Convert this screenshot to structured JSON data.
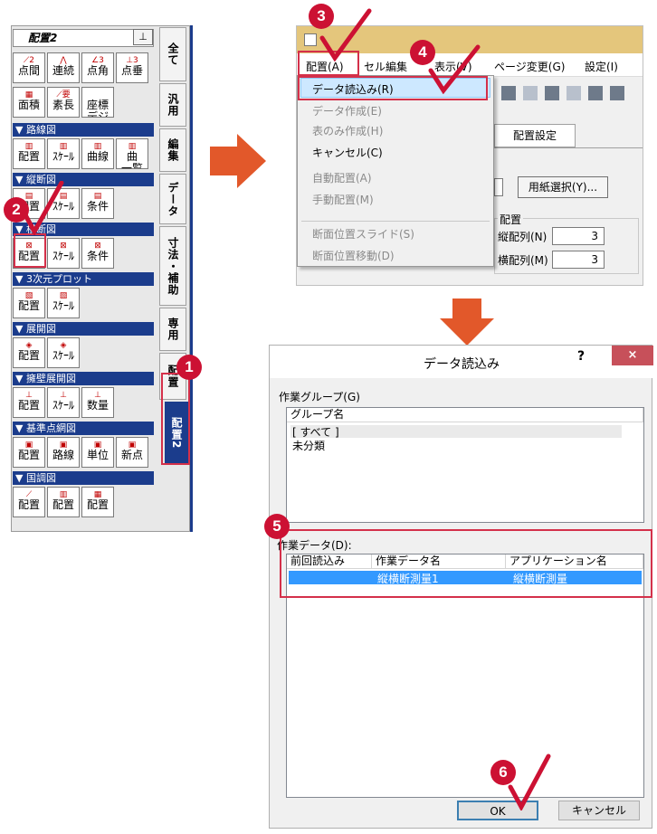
{
  "palette": {
    "title": "配置2",
    "pin": "⊥",
    "rows": [
      [
        {
          "l1": "点間",
          "icon": "⟋2"
        },
        {
          "l1": "連続",
          "icon": "⋀"
        },
        {
          "l1": "点角",
          "icon": "∠3"
        },
        {
          "l1": "点垂",
          "icon": "⊥3"
        }
      ],
      [
        {
          "l1": "面積",
          "icon": "▦"
        },
        {
          "l1": "素長",
          "icon": "⟋要"
        },
        {
          "l1": "座標\nデジ",
          "icon": ""
        }
      ]
    ],
    "sections": [
      {
        "title": "▼ 路線図",
        "buttons": [
          {
            "label": "配置",
            "icon": "▥"
          },
          {
            "label": "ｽｹｰﾙ",
            "icon": "▥"
          },
          {
            "label": "曲線",
            "icon": "▥"
          },
          {
            "label": "曲\n一覧",
            "icon": "▥"
          }
        ]
      },
      {
        "title": "▼ 縦断図",
        "buttons": [
          {
            "label": "配置",
            "icon": "▤"
          },
          {
            "label": "ｽｹｰﾙ",
            "icon": "▤"
          },
          {
            "label": "条件",
            "icon": "▤"
          }
        ]
      },
      {
        "title": "▼ 横断図",
        "buttons": [
          {
            "label": "配置",
            "icon": "⊠"
          },
          {
            "label": "ｽｹｰﾙ",
            "icon": "⊠"
          },
          {
            "label": "条件",
            "icon": "⊠"
          }
        ]
      },
      {
        "title": "▼ 3次元プロット",
        "buttons": [
          {
            "label": "配置",
            "icon": "▧"
          },
          {
            "label": "ｽｹｰﾙ",
            "icon": "▧"
          }
        ]
      },
      {
        "title": "▼ 展開図",
        "buttons": [
          {
            "label": "配置",
            "icon": "◈"
          },
          {
            "label": "ｽｹｰﾙ",
            "icon": "◈"
          }
        ]
      },
      {
        "title": "▼ 擁壁展開図",
        "buttons": [
          {
            "label": "配置",
            "icon": "⊥"
          },
          {
            "label": "ｽｹｰﾙ",
            "icon": "⊥"
          },
          {
            "label": "数量",
            "icon": "⊥"
          }
        ]
      },
      {
        "title": "▼ 基準点網図",
        "buttons": [
          {
            "label": "配置",
            "icon": "▣"
          },
          {
            "label": "路線",
            "icon": "▣"
          },
          {
            "label": "単位",
            "icon": "▣"
          },
          {
            "label": "新点",
            "icon": "▣"
          }
        ]
      },
      {
        "title": "▼ 国調図",
        "buttons": [
          {
            "label": "配置",
            "icon": "⟋"
          },
          {
            "label": "配置",
            "icon": "▥"
          },
          {
            "label": "配置",
            "icon": "▦"
          }
        ]
      }
    ],
    "tabs": [
      "全て",
      "汎用",
      "編集",
      "データ",
      "寸法・補助",
      "専用",
      "配置",
      "配置2"
    ]
  },
  "menu": {
    "items": [
      "配置(A)",
      "セル編集",
      "表示(V)",
      "ページ変更(G)",
      "設定(I)"
    ],
    "dropdown": [
      {
        "label": "データ読込み(R)",
        "enabled": true
      },
      {
        "label": "データ作成(E)",
        "enabled": false
      },
      {
        "label": "表のみ作成(H)",
        "enabled": false
      },
      {
        "label": "キャンセル(C)",
        "enabled": true
      },
      {
        "label": "自動配置(A)",
        "enabled": false
      },
      {
        "label": "手動配置(M)",
        "enabled": false
      },
      {
        "label": "断面位置スライド(S)",
        "enabled": false
      },
      {
        "label": "断面位置移動(D)",
        "enabled": false
      }
    ],
    "config_tab": "配置設定",
    "paper_button": "用紙選択(Y)...",
    "group_label": "配置",
    "vert_label": "縦配列(N)",
    "horiz_label": "横配列(M)",
    "vert_value": "3",
    "horiz_value": "3"
  },
  "dialog": {
    "title": "データ読込み",
    "help": "?",
    "close": "×",
    "group_section": "作業グループ(G)",
    "group_header": "グループ名",
    "groups": [
      "[ すべて ]",
      "未分類"
    ],
    "data_section": "作業データ(D):",
    "columns": [
      "前回読込み",
      "作業データ名",
      "アプリケーション名"
    ],
    "rows": [
      {
        "last": "",
        "name": "縦横断測量1",
        "app": "縦横断測量"
      }
    ],
    "ok": "OK",
    "cancel": "キャンセル"
  },
  "steps": [
    "1",
    "2",
    "3",
    "4",
    "5",
    "6"
  ],
  "colors": {
    "accent": "#cc1133",
    "palette_header": "#1b3c8c",
    "selection": "#3399ff",
    "arrow": "#e2582a"
  }
}
